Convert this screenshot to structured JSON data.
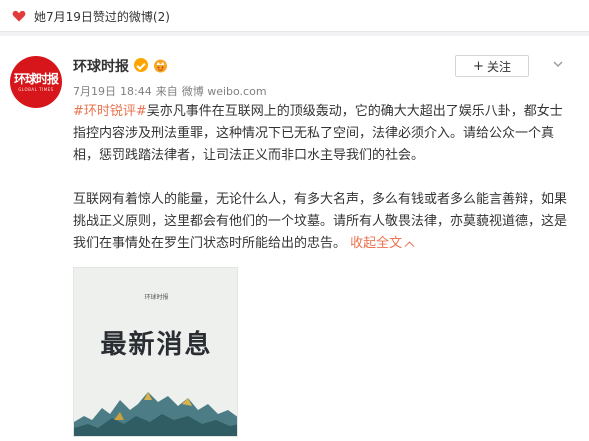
{
  "top_bar": {
    "text": "她7月19日赞过的微博(2)"
  },
  "post": {
    "author": "环球时报",
    "avatar_text": "环球时报",
    "avatar_subtext": "GLOBAL TIMES",
    "follow_label": "关注",
    "date": "7月19日",
    "time": "18:44",
    "source_prefix": "来自",
    "source": "微博 weibo.com",
    "hashtag": "#环时锐评#",
    "paragraph1_rest": "吴亦凡事件在互联网上的顶级轰动，它的确大大超出了娱乐八卦，都女士指控内容涉及刑法重罪，这种情况下已无私了空间，法律必须介入。请给公众一个真相，惩罚践踏法律者，让司法正义而非口水主导我们的社会。",
    "paragraph2": "互联网有着惊人的能量，无论什么人，有多大名声，多么有钱或者多么能言善辩，如果挑战正义原则，这里都会有他们的一个坟墓。请所有人敬畏法律，亦莫藐视道德，这是我们在事情处在罗生门状态时所能给出的忠告。",
    "collapse_label": "收起全文",
    "image": {
      "brand": "环球时报",
      "headline": "最新消息"
    }
  },
  "colors": {
    "accent": "#eb7350",
    "brand_red": "#d6161a",
    "verify": "#ffa500"
  },
  "icons": {
    "top_bar": "heart-icon",
    "verify": "verified-badge-icon",
    "vip": "vip-crown-icon",
    "menu": "chevron-down-icon"
  }
}
